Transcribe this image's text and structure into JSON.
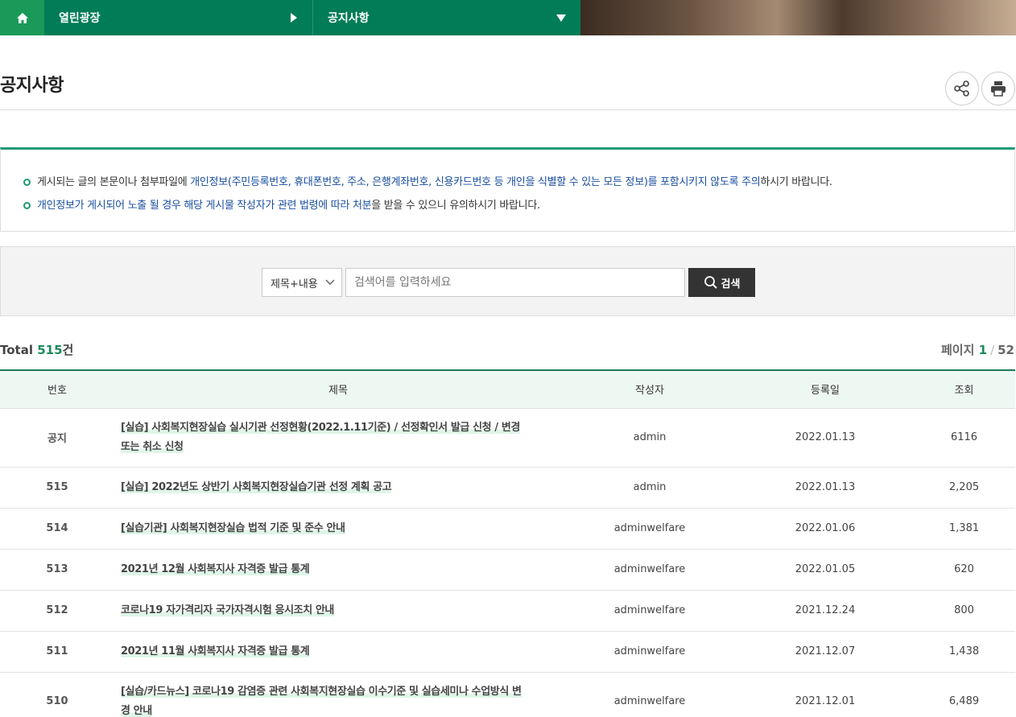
{
  "nav": {
    "level1": "열린광장",
    "level2": "공지사항"
  },
  "page_title": "공지사항",
  "notice": {
    "line1_pre": "게시되는 글의 본문이나 첨부파일에 ",
    "line1_hl": "개인정보(주민등록번호, 휴대폰번호, 주소, 은행계좌번호, 신용카드번호 등 개인을 식별할 수 있는 모든 정보)를 포함시키지 않도록 주의",
    "line1_post": "하시기 바랍니다.",
    "line2_hl": "개인정보가 게시되어 노출 될 경우 해당 게시물 작성자가 관련 법령에 따라 처분",
    "line2_post": "을 받을 수 있으니 유의하시기 바랍니다."
  },
  "search": {
    "select_value": "제목+내용",
    "placeholder": "검색어를 입력하세요",
    "button_label": "검색"
  },
  "summary": {
    "total_label": "Total",
    "total_count": "515",
    "total_unit": "건",
    "page_label": "페이지",
    "current_page": "1",
    "total_pages": "52"
  },
  "table": {
    "headers": [
      "번호",
      "제목",
      "작성자",
      "등록일",
      "조회"
    ],
    "rows": [
      {
        "no": "공지",
        "title": "[실습] 사회복지현장실습 실시기관 선정현황(2022.1.11기준) / 선정확인서 발급 신청 / 변경 또는 취소 신청",
        "author": "admin",
        "date": "2022.01.13",
        "views": "6116"
      },
      {
        "no": "515",
        "title": "[실습] 2022년도 상반기 사회복지현장실습기관 선정 계획 공고",
        "author": "admin",
        "date": "2022.01.13",
        "views": "2,205"
      },
      {
        "no": "514",
        "title": "[실습기관] 사회복지현장실습 법적 기준 및 준수 안내",
        "author": "adminwelfare",
        "date": "2022.01.06",
        "views": "1,381"
      },
      {
        "no": "513",
        "title": "2021년 12월 사회복지사 자격증 발급 통계",
        "author": "adminwelfare",
        "date": "2022.01.05",
        "views": "620"
      },
      {
        "no": "512",
        "title": "코로나19 자가격리자 국가자격시험 응시조치 안내",
        "author": "adminwelfare",
        "date": "2021.12.24",
        "views": "800"
      },
      {
        "no": "511",
        "title": "2021년 11월 사회복지사 자격증 발급 통계",
        "author": "adminwelfare",
        "date": "2021.12.07",
        "views": "1,438"
      },
      {
        "no": "510",
        "title": "[실습/카드뉴스] 코로나19 감염증 관련 사회복지현장실습 이수기준 및 실습세미나 수업방식 변경 안내",
        "author": "adminwelfare",
        "date": "2021.12.01",
        "views": "6,489"
      }
    ]
  }
}
